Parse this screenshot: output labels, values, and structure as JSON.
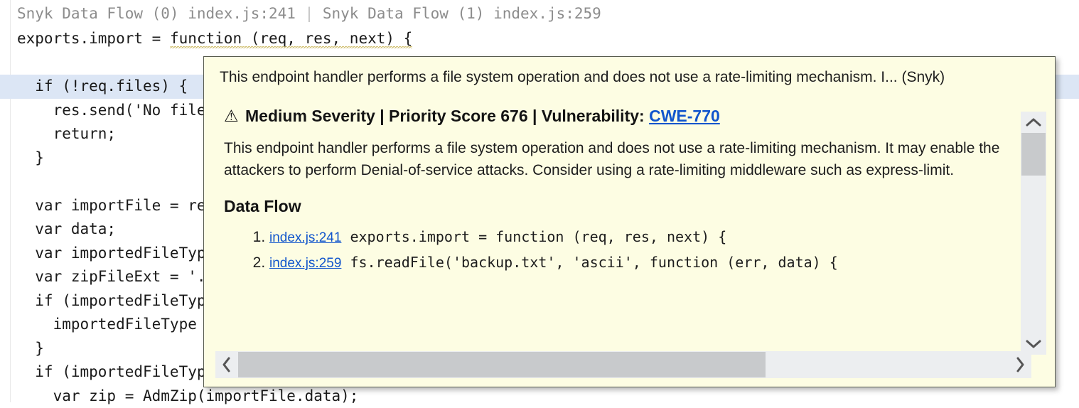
{
  "editor": {
    "breadcrumb": {
      "left": "Snyk Data Flow (0) index.js:241",
      "separator": " | ",
      "right": "Snyk Data Flow (1) index.js:259"
    },
    "lines": [
      {
        "text": "exports.import = function (req, res, next) {",
        "highlight": false,
        "squiggle": true
      },
      {
        "text": "",
        "highlight": false,
        "squiggle": false
      },
      {
        "text": "  if (!req.files) {",
        "highlight": true,
        "squiggle": false
      },
      {
        "text": "    res.send('No files were uploaded.');",
        "highlight": false,
        "squiggle": false
      },
      {
        "text": "    return;",
        "highlight": false,
        "squiggle": false
      },
      {
        "text": "  }",
        "highlight": false,
        "squiggle": false
      },
      {
        "text": "",
        "highlight": false,
        "squiggle": false
      },
      {
        "text": "  var importFile = req.files.importFile;",
        "highlight": false,
        "squiggle": false
      },
      {
        "text": "  var data;",
        "highlight": false,
        "squiggle": false
      },
      {
        "text": "  var importedFileType = importFile.mimetype;",
        "highlight": false,
        "squiggle": false
      },
      {
        "text": "  var zipFileExt = '.zip';",
        "highlight": false,
        "squiggle": false
      },
      {
        "text": "  if (importedFileType) {",
        "highlight": false,
        "squiggle": false
      },
      {
        "text": "    importedFileType = importedFileType.toLowerCase();",
        "highlight": false,
        "squiggle": false
      },
      {
        "text": "  }",
        "highlight": false,
        "squiggle": false
      },
      {
        "text": "  if (importedFileType === 'application/zip') {",
        "highlight": false,
        "squiggle": false
      },
      {
        "text": "    var zip = AdmZip(importFile.data);",
        "highlight": false,
        "squiggle": false
      }
    ]
  },
  "hover": {
    "header_text": "This endpoint handler performs a file system operation and does not use a rate-limiting mechanism. I... (Snyk)",
    "severity": {
      "warn_icon": "⚠",
      "text_before_link": " Medium Severity | Priority Score 676 | Vulnerability: ",
      "severity_label": "Medium Severity",
      "priority_score": "676",
      "priority_label": "Priority Score 676",
      "vulnerability_label": "Vulnerability:",
      "cwe_link": "CWE-770",
      "link_color": "#1155cc"
    },
    "description": "This endpoint handler performs a file system operation and does not use a rate-limiting mechanism. It may enable the attackers to perform Denial-of-service attacks. Consider using a rate-limiting middleware such as express-limit.",
    "dataflow": {
      "heading": "Data Flow",
      "items": [
        {
          "link": "index.js:241",
          "code": " exports.import = function (req, res, next) {"
        },
        {
          "link": "index.js:259",
          "code": " fs.readFile('backup.txt', 'ascii', function (err, data) {"
        }
      ]
    },
    "scrollbars": {
      "vertical": {
        "up": "∧",
        "down": "∨"
      },
      "horizontal": {
        "left": "‹",
        "right": "›"
      }
    },
    "background_color": "#fdfde3",
    "border_color": "#585c4e"
  }
}
